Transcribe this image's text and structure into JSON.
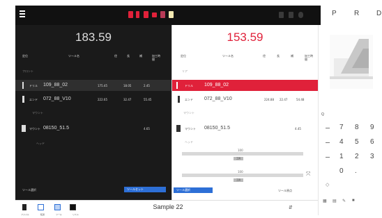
{
  "prtabs": [
    "P",
    "R",
    "D"
  ],
  "left": {
    "value": "183.59",
    "headers": [
      "定位",
      "ツール名",
      "径",
      "長",
      "補",
      "加工時間"
    ],
    "subhdr": "フロント",
    "rows": [
      {
        "lbl": "ドリル",
        "name": "109_88_02",
        "v1": "175.45",
        "v2": "18.05",
        "v3": "2.45"
      },
      {
        "lbl": "エンド",
        "name": "072_88_V10",
        "v1": "222.65",
        "v2": "32.47",
        "v3": "55.45"
      },
      {
        "lbl": "マウント",
        "name": "08150_51.5",
        "v1": "",
        "v2": "",
        "v3": "4.65"
      }
    ],
    "midlbl": "マウント",
    "sublbl": "ヘッド",
    "btn_left": "ツール選択",
    "btn_right": "ツールセット"
  },
  "right": {
    "value": "153.59",
    "headers": [
      "定位",
      "ツール名",
      "径",
      "長",
      "補",
      "加工時間"
    ],
    "subhdr": "リア",
    "rows": [
      {
        "lbl": "ドリル",
        "name": "109_88_02",
        "v1": "",
        "v2": "",
        "v3": ""
      },
      {
        "lbl": "エンド",
        "name": "072_88_V10",
        "v1": "224.88",
        "v2": "22.47",
        "v3": "54.48"
      },
      {
        "lbl": "マウント",
        "name": "08150_51.5",
        "v1": "",
        "v2": "",
        "v3": "4.45"
      }
    ],
    "midlbl": "マウント",
    "sublbl": "ヘッド",
    "bar1_val": "100",
    "bar1_lbl": "工具",
    "bar2_val": "100",
    "bar2_lbl": "工具",
    "btn_left": "ツール選択",
    "btn_right": "ツール原点"
  },
  "lower": {
    "sample": "Sample 22",
    "labels": [
      "ファイル",
      "転送",
      "ツール",
      "ツール",
      "リスト"
    ]
  },
  "keypad": {
    "label": "Q",
    "keys": [
      "7",
      "8",
      "9",
      "4",
      "5",
      "6",
      "1",
      "2",
      "3",
      "0",
      "."
    ]
  },
  "colors": {
    "accent_red": "#e0213a",
    "accent_blue": "#2d6fd6"
  }
}
